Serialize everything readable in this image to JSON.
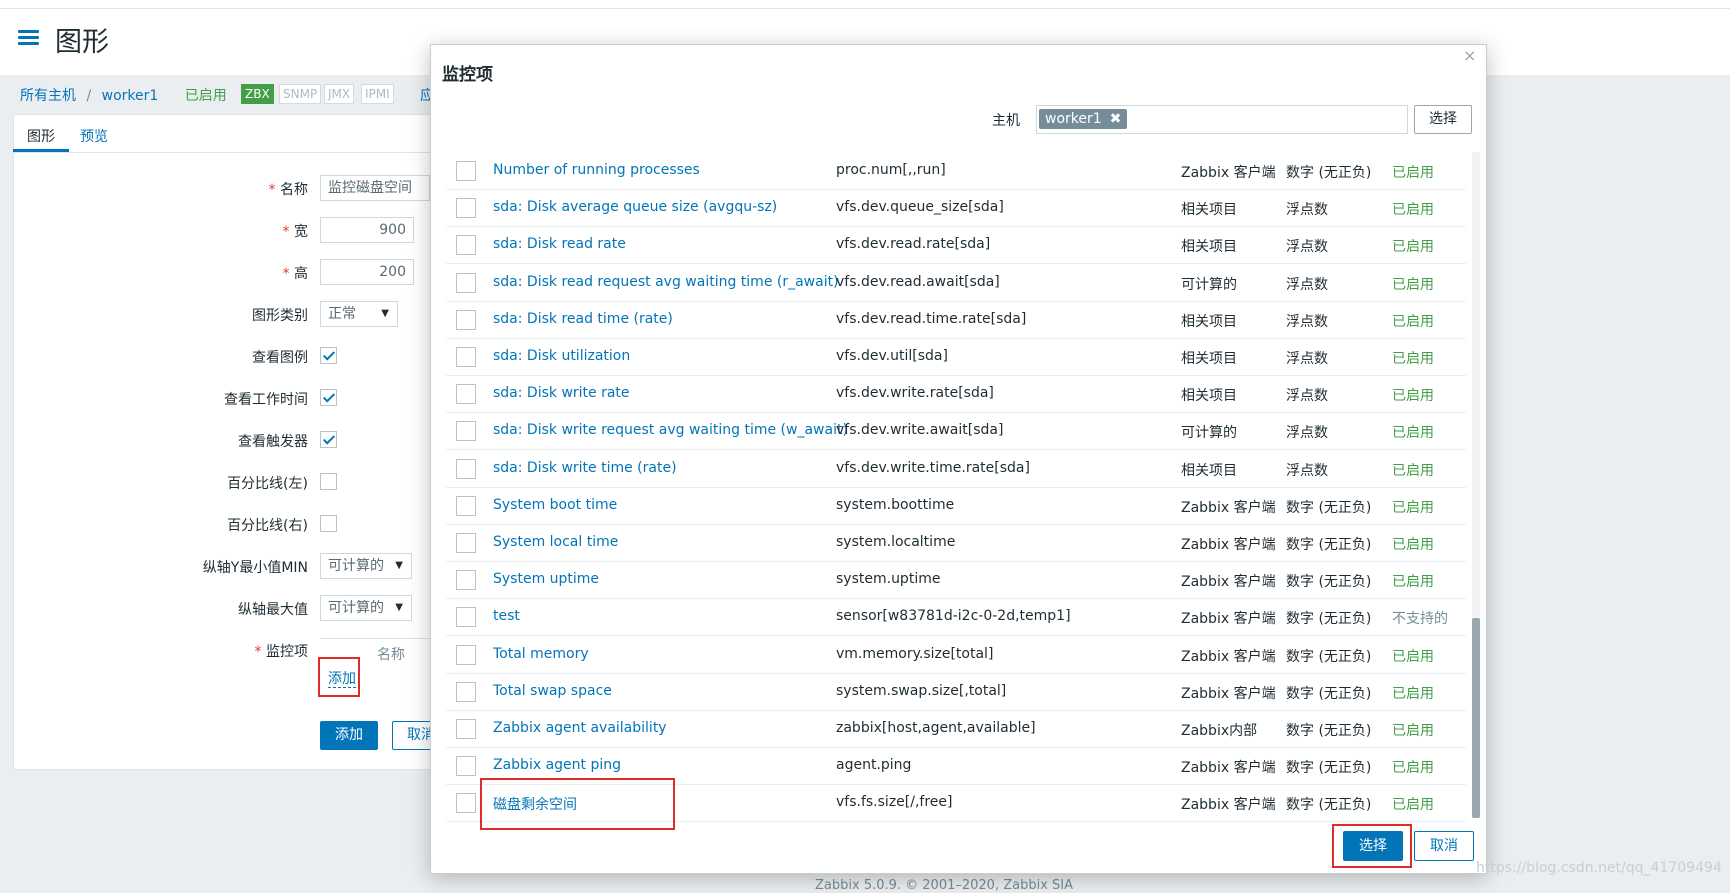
{
  "header": {
    "title": "图形"
  },
  "breadcrumb": {
    "all_hosts": "所有主机",
    "sep": "/",
    "host": "worker1",
    "status": "已启用",
    "partial": "应"
  },
  "interfaces": [
    "ZBX",
    "SNMP",
    "JMX",
    "IPMI"
  ],
  "tabs": {
    "graph": "图形",
    "preview": "预览"
  },
  "form": {
    "name_label": "名称",
    "name_value": "监控磁盘空间",
    "width_label": "宽",
    "width_value": "900",
    "height_label": "高",
    "height_value": "200",
    "graph_type_label": "图形类别",
    "graph_type_value": "正常",
    "show_legend_label": "查看图例",
    "show_working_time_label": "查看工作时间",
    "show_triggers_label": "查看触发器",
    "percentile_left_label": "百分比线(左)",
    "percentile_right_label": "百分比线(右)",
    "y_min_label": "纵轴Y最小值MIN",
    "y_min_value": "可计算的",
    "y_max_label": "纵轴最大值",
    "y_max_value": "可计算的",
    "items_label": "监控项",
    "items_col_name": "名称",
    "add_link": "添加",
    "add_button": "添加",
    "cancel_button": "取消"
  },
  "footer": "Zabbix 5.0.9. © 2001–2020, Zabbix SIA",
  "dialog": {
    "title": "监控项",
    "close": "×",
    "host_label": "主机",
    "host_chip": "worker1",
    "host_chip_remove": "✖",
    "host_select": "选择",
    "rows": [
      {
        "name": "Number of running processes",
        "key": "proc.num[,,run]",
        "type": "Zabbix 客户端",
        "info": "数字 (无正负)",
        "status": "已启用"
      },
      {
        "name": "sda: Disk average queue size (avgqu-sz)",
        "key": "vfs.dev.queue_size[sda]",
        "type": "相关项目",
        "info": "浮点数",
        "status": "已启用"
      },
      {
        "name": "sda: Disk read rate",
        "key": "vfs.dev.read.rate[sda]",
        "type": "相关项目",
        "info": "浮点数",
        "status": "已启用"
      },
      {
        "name": "sda: Disk read request avg waiting time (r_await)",
        "key": "vfs.dev.read.await[sda]",
        "type": "可计算的",
        "info": "浮点数",
        "status": "已启用"
      },
      {
        "name": "sda: Disk read time (rate)",
        "key": "vfs.dev.read.time.rate[sda]",
        "type": "相关项目",
        "info": "浮点数",
        "status": "已启用"
      },
      {
        "name": "sda: Disk utilization",
        "key": "vfs.dev.util[sda]",
        "type": "相关项目",
        "info": "浮点数",
        "status": "已启用"
      },
      {
        "name": "sda: Disk write rate",
        "key": "vfs.dev.write.rate[sda]",
        "type": "相关项目",
        "info": "浮点数",
        "status": "已启用"
      },
      {
        "name": "sda: Disk write request avg waiting time (w_await)",
        "key": "vfs.dev.write.await[sda]",
        "type": "可计算的",
        "info": "浮点数",
        "status": "已启用"
      },
      {
        "name": "sda: Disk write time (rate)",
        "key": "vfs.dev.write.time.rate[sda]",
        "type": "相关项目",
        "info": "浮点数",
        "status": "已启用"
      },
      {
        "name": "System boot time",
        "key": "system.boottime",
        "type": "Zabbix 客户端",
        "info": "数字 (无正负)",
        "status": "已启用"
      },
      {
        "name": "System local time",
        "key": "system.localtime",
        "type": "Zabbix 客户端",
        "info": "数字 (无正负)",
        "status": "已启用"
      },
      {
        "name": "System uptime",
        "key": "system.uptime",
        "type": "Zabbix 客户端",
        "info": "数字 (无正负)",
        "status": "已启用"
      },
      {
        "name": "test",
        "key": "sensor[w83781d-i2c-0-2d,temp1]",
        "type": "Zabbix 客户端",
        "info": "数字 (无正负)",
        "status": "不支持的"
      },
      {
        "name": "Total memory",
        "key": "vm.memory.size[total]",
        "type": "Zabbix 客户端",
        "info": "数字 (无正负)",
        "status": "已启用"
      },
      {
        "name": "Total swap space",
        "key": "system.swap.size[,total]",
        "type": "Zabbix 客户端",
        "info": "数字 (无正负)",
        "status": "已启用"
      },
      {
        "name": "Zabbix agent availability",
        "key": "zabbix[host,agent,available]",
        "type": "Zabbix内部",
        "info": "数字 (无正负)",
        "status": "已启用"
      },
      {
        "name": "Zabbix agent ping",
        "key": "agent.ping",
        "type": "Zabbix 客户端",
        "info": "数字 (无正负)",
        "status": "已启用"
      },
      {
        "name": "磁盘剩余空间",
        "key": "vfs.fs.size[/,free]",
        "type": "Zabbix 客户端",
        "info": "数字 (无正负)",
        "status": "已启用"
      }
    ],
    "select_button": "选择",
    "cancel_button": "取消"
  },
  "watermark": "https://blog.csdn.net/qq_41709494",
  "colors": {
    "accent": "#0275b8",
    "enabled": "#429e47",
    "highlight": "#e02b2b"
  }
}
